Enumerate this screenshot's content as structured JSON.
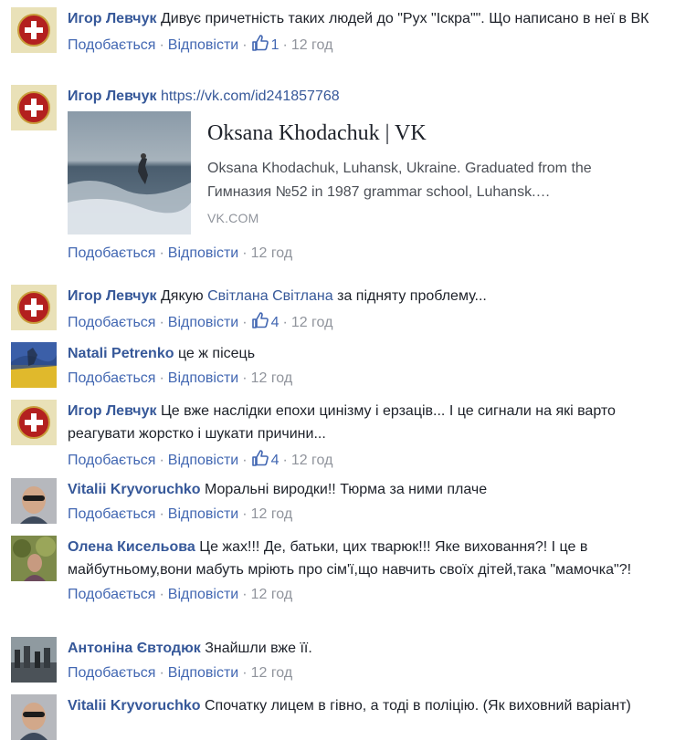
{
  "actions": {
    "like": "Подобається",
    "reply": "Відповісти",
    "sep": "·"
  },
  "comments": [
    {
      "author": "Игор Левчук",
      "text": "Дивує причетність таких людей до \"Рух \"Іскра\"\". Що написано в неї в ВК",
      "likes": "1",
      "time": "12 год",
      "avatar": "emblem"
    },
    {
      "author": "Игор Левчук",
      "text": "https://vk.com/id241857768",
      "preview": {
        "title": "Oksana Khodachuk | VK",
        "description": "Oksana Khodachuk, Luhansk, Ukraine. Graduated from the Гимназия №52 in 1987 grammar school, Luhansk.…",
        "domain": "VK.COM"
      },
      "time": "12 год",
      "avatar": "emblem"
    },
    {
      "author": "Игор Левчук",
      "text_before": "Дякую",
      "mention": "Світлана Світлана",
      "text_after": "за підняту проблему...",
      "likes": "4",
      "time": "12 год",
      "avatar": "emblem"
    },
    {
      "author": "Natali Petrenko",
      "text": "це ж пісець",
      "time": "12 год",
      "avatar": "flag-photo"
    },
    {
      "author": "Игор Левчук",
      "text": "Це вже наслідки епохи цинізму і ерзаців... І це сигнали на які варто реагувати жорстко і шукати причини...",
      "likes": "4",
      "time": "12 год",
      "avatar": "emblem"
    },
    {
      "author": "Vitalii Kryvoruchko",
      "text": "Моральні виродки!! Тюрма за ними плаче",
      "time": "12 год",
      "avatar": "man-photo"
    },
    {
      "author": "Олена Кисельова",
      "text": "Це жах!!! Де, батьки, цих тварюк!!! Яке виховання?! І це в майбутньому,вони мабуть мріють про сім'ї,що навчить своїх дітей,така \"мамочка\"?!",
      "time": "12 год",
      "avatar": "nature-photo"
    },
    {
      "author": "Антоніна Євтодюк",
      "text": "Знайшли вже її.",
      "time": "12 год",
      "avatar": "crowd-photo"
    },
    {
      "author": "Vitalii Kryvoruchko",
      "text": "Спочатку лицем в гівно, а тоді в поліцію. (Як виховний варіант)",
      "avatar": "man-photo"
    }
  ]
}
